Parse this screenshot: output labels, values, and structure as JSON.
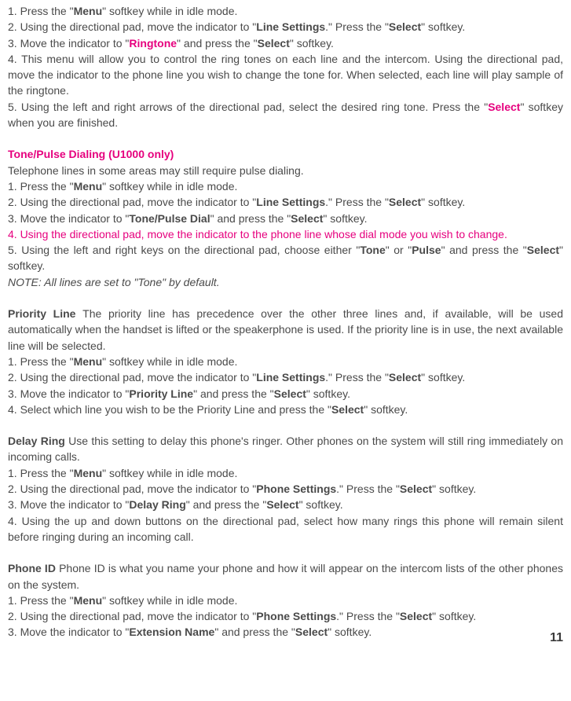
{
  "sec1": {
    "l1a": "1. Press the \"",
    "l1b": "Menu",
    "l1c": "\" softkey while in idle mode.",
    "l2a": "2. Using the directional pad, move the indicator to \"",
    "l2b": "Line Settings",
    "l2c": ".\"  Press the \"",
    "l2d": "Select",
    "l2e": "\" softkey.",
    "l3a": "3. Move the indicator to \"",
    "l3b": "Ringtone",
    "l3c": "\" and press the \"",
    "l3d": "Select",
    "l3e": "\" softkey.",
    "l4": "4. This menu will allow you to control the ring tones on each line and the intercom.  Using the directional pad, move the indicator to the phone line you wish to change the tone for.  When selected, each line will play sample of the ringtone.",
    "l5a": "5. Using the left and right arrows of the directional pad, select the desired ring tone. Press the \"",
    "l5b": "Select",
    "l5c": "\" softkey when you are finished."
  },
  "sec2": {
    "heading": "Tone/Pulse Dialing (U1000 only)",
    "intro": "Telephone lines in some areas may still require pulse dialing.",
    "l1a": "1. Press the \"",
    "l1b": "Menu",
    "l1c": "\" softkey while in idle mode.",
    "l2a": "2. Using the directional pad, move the indicator to \"",
    "l2b": "Line Settings",
    "l2c": ".\"  Press the \"",
    "l2d": "Select",
    "l2e": "\" softkey.",
    "l3a": "3. Move the indicator to \"",
    "l3b": "Tone/Pulse Dial",
    "l3c": "\" and press the \"",
    "l3d": "Select",
    "l3e": "\" softkey.",
    "l4": "4. Using the directional pad, move the indicator to the phone line whose dial mode you wish to change.",
    "l5a": "5. Using the left and right keys on the directional pad, choose either \"",
    "l5b": "Tone",
    "l5c": "\" or \"",
    "l5d": "Pulse",
    "l5e": "\" and press the \"",
    "l5f": "Select",
    "l5g": "\" softkey.",
    "note": "NOTE:  All lines are set to \"Tone\" by default."
  },
  "sec3": {
    "heading": "Priority Line",
    "intro": "The priority line has precedence over the other three lines and, if available, will be used automatically when the handset is lifted or the speakerphone is used.  If the priority line is in use, the next available line will be selected.",
    "l1a": "1. Press the \"",
    "l1b": "Menu",
    "l1c": "\" softkey while in idle mode.",
    "l2a": "2. Using the directional pad, move the indicator to \"",
    "l2b": "Line Settings",
    "l2c": ".\"  Press the \"",
    "l2d": "Select",
    "l2e": "\" softkey.",
    "l3a": "3. Move the indicator to \"",
    "l3b": "Priority Line",
    "l3c": "\" and press the \"",
    "l3d": "Select",
    "l3e": "\" softkey.",
    "l4a": "4. Select which line you wish to be the Priority Line and press the \"",
    "l4b": "Select",
    "l4c": "\" softkey."
  },
  "sec4": {
    "heading": "Delay Ring",
    "intro": "Use this setting to delay this phone's ringer.  Other phones on the system will still ring immediately on incoming calls.",
    "l1a": "1.  Press the \"",
    "l1b": "Menu",
    "l1c": "\" softkey while in idle mode.",
    "l2a": "2.  Using the directional pad, move the indicator to \"",
    "l2b": "Phone Settings",
    "l2c": ".\"  Press the \"",
    "l2d": "Select",
    "l2e": "\" softkey.",
    "l3a": "3.  Move the indicator to \"",
    "l3b": "Delay Ring",
    "l3c": "\" and press the \"",
    "l3d": "Select",
    "l3e": "\" softkey.",
    "l4": "4.  Using the up and down buttons on the directional pad, select how many rings this phone will remain silent before ringing during an incoming call."
  },
  "sec5": {
    "heading": "Phone ID",
    "intro": "Phone ID is what you name your phone and how it will appear on the intercom lists of the other phones on the system.",
    "l1a": "1. Press the \"",
    "l1b": "Menu",
    "l1c": "\" softkey while in idle mode.",
    "l2a": "2. Using the directional pad, move the indicator to \"",
    "l2b": "Phone Settings",
    "l2c": ".\"  Press the \"",
    "l2d": "Select",
    "l2e": "\" softkey.",
    "l3a": "3. Move the indicator to \"",
    "l3b": "Extension Name",
    "l3c": "\" and press the \"",
    "l3d": "Select",
    "l3e": "\" softkey."
  },
  "page": "11"
}
